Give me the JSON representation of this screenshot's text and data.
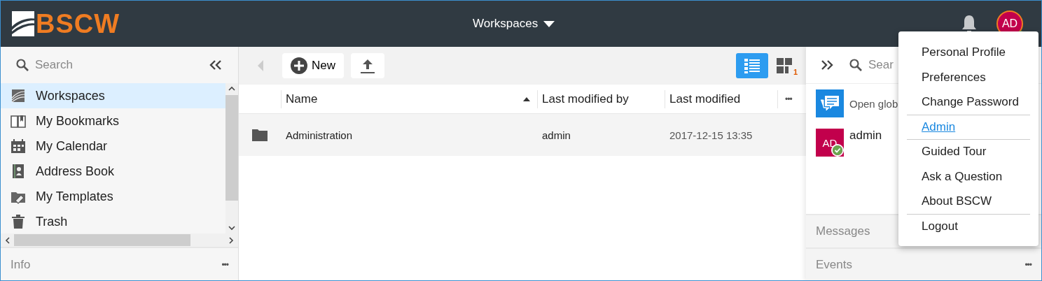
{
  "header": {
    "logo": "BSCW",
    "nav": "Workspaces",
    "avatar": "AD",
    "online": true
  },
  "sidebar": {
    "search": {
      "placeholder": "Search"
    },
    "items": [
      {
        "label": "Workspaces",
        "kind": "workspaces",
        "selected": true
      },
      {
        "label": "My Bookmarks",
        "kind": "bookmarks",
        "selected": false
      },
      {
        "label": "My Calendar",
        "kind": "calendar",
        "selected": false
      },
      {
        "label": "Address Book",
        "kind": "addressbook",
        "selected": false
      },
      {
        "label": "My Templates",
        "kind": "templates",
        "selected": false
      },
      {
        "label": "Trash",
        "kind": "trash",
        "selected": false
      }
    ],
    "footer": {
      "label": "Info",
      "more": "•••"
    }
  },
  "toolbar": {
    "new_label": "New",
    "views": [
      {
        "kind": "list",
        "selected": true
      },
      {
        "kind": "grid",
        "selected": false,
        "badge": "1"
      }
    ]
  },
  "table": {
    "columns": [
      {
        "label": "Name",
        "sorted": true
      },
      {
        "label": "Last modified by",
        "sorted": false
      },
      {
        "label": "Last modified",
        "sorted": false
      }
    ],
    "more": "•••",
    "rows": [
      {
        "name": "Administration",
        "modified_by": "admin",
        "modified": "2017-12-15 13:35"
      }
    ]
  },
  "right_panel": {
    "search": {
      "placeholder": "Sear"
    },
    "items": [
      {
        "kind": "chat",
        "label": "Open glob"
      },
      {
        "kind": "user",
        "initials": "AD",
        "label": "admin",
        "online": true
      }
    ],
    "sections": [
      {
        "label": "Messages"
      },
      {
        "label": "Events",
        "more": "•••"
      }
    ]
  },
  "user_menu": [
    {
      "label": "Personal Profile",
      "kind": "item",
      "divider_before": false
    },
    {
      "label": "Preferences",
      "kind": "item",
      "divider_before": false
    },
    {
      "label": "Change Password",
      "kind": "item",
      "divider_before": false
    },
    {
      "label": "Admin",
      "kind": "link",
      "divider_before": true
    },
    {
      "label": "Guided Tour",
      "kind": "item",
      "divider_before": true
    },
    {
      "label": "Ask a Question",
      "kind": "item",
      "divider_before": false
    },
    {
      "label": "About BSCW",
      "kind": "item",
      "divider_before": false
    },
    {
      "label": "Logout",
      "kind": "item",
      "divider_before": true
    }
  ]
}
